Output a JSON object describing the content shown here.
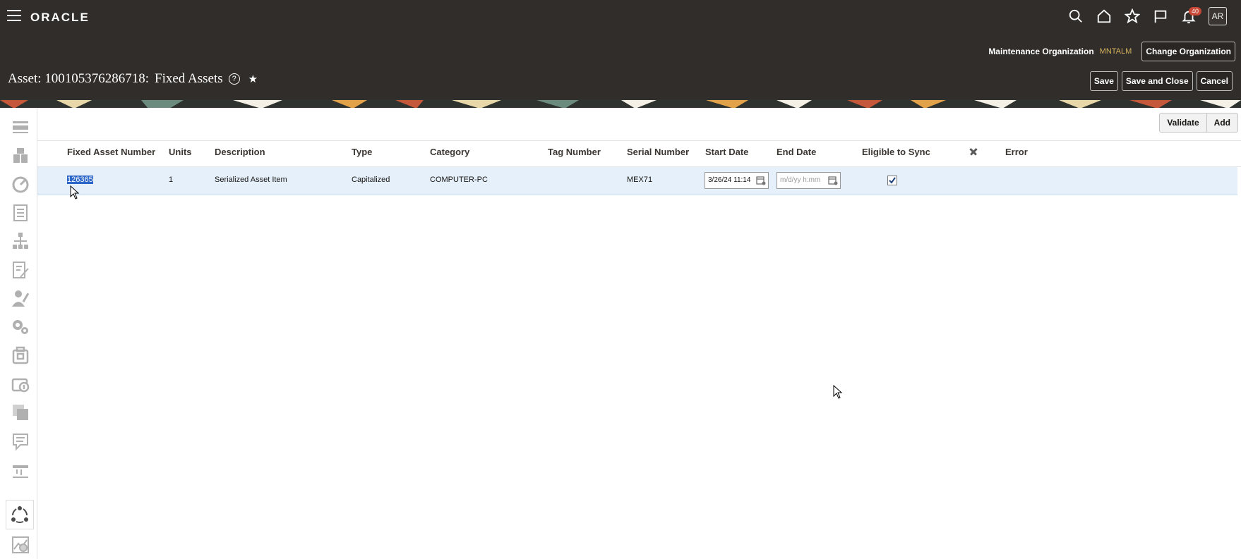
{
  "header": {
    "logo": "ORACLE",
    "notifications_count": "40",
    "avatar_initials": "AR",
    "icons": [
      "search-icon",
      "home-icon",
      "star-icon",
      "flag-icon",
      "bell-icon"
    ]
  },
  "org": {
    "label": "Maintenance Organization",
    "value": "MNTALM",
    "change_button": "Change Organization"
  },
  "title": {
    "text": "Asset: 100105376286718:",
    "section": "Fixed Assets",
    "help": "?",
    "favorite": "★"
  },
  "actions": {
    "save": "Save",
    "save_close": "Save and Close",
    "cancel": "Cancel"
  },
  "toolbar": {
    "validate": "Validate",
    "add": "Add"
  },
  "table": {
    "columns": {
      "fixed_asset_number": "Fixed Asset Number",
      "units": "Units",
      "description": "Description",
      "type": "Type",
      "category": "Category",
      "tag_number": "Tag Number",
      "serial_number": "Serial Number",
      "start_date": "Start Date",
      "end_date": "End Date",
      "eligible_to_sync": "Eligible to Sync",
      "error": "Error"
    },
    "row": {
      "fixed_asset_number": "126365",
      "units": "1",
      "description": "Serialized Asset Item",
      "type": "Capitalized",
      "category": "COMPUTER-PC",
      "tag_number": "",
      "serial_number": "MEX71",
      "start_date": "3/26/24 11:14",
      "end_date_placeholder": "m/d/yy h:mm",
      "eligible_to_sync": true
    }
  },
  "colors": {
    "header_bg": "#312d2a",
    "org_value": "#d4b35c",
    "row_highlight": "#e6f0fa",
    "selection": "#2b66c8",
    "badge": "#c74634"
  }
}
